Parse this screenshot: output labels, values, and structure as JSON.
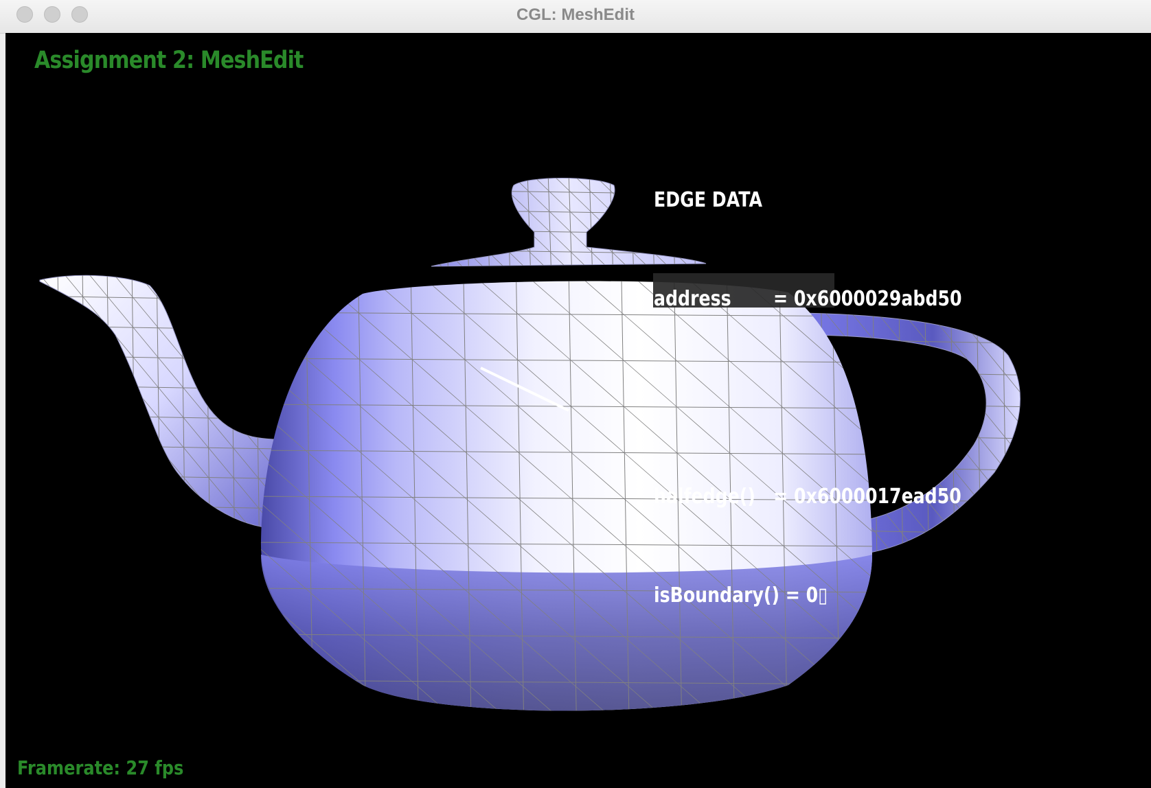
{
  "window": {
    "title": "CGL: MeshEdit"
  },
  "viewport": {
    "heading": "Assignment 2: MeshEdit",
    "framerate": "Framerate: 27 fps",
    "edge_data": {
      "header": "EDGE DATA",
      "address": "address       = 0x6000029abd50",
      "halfedge": "halfedge()   = 0x6000017ead50",
      "is_boundary": "isBoundary() = 0▯"
    }
  },
  "colors": {
    "heading_green": "#2a8a2a",
    "mesh_light": "#ffffff",
    "mesh_dark": "#7070e0",
    "wire": "#808080"
  }
}
